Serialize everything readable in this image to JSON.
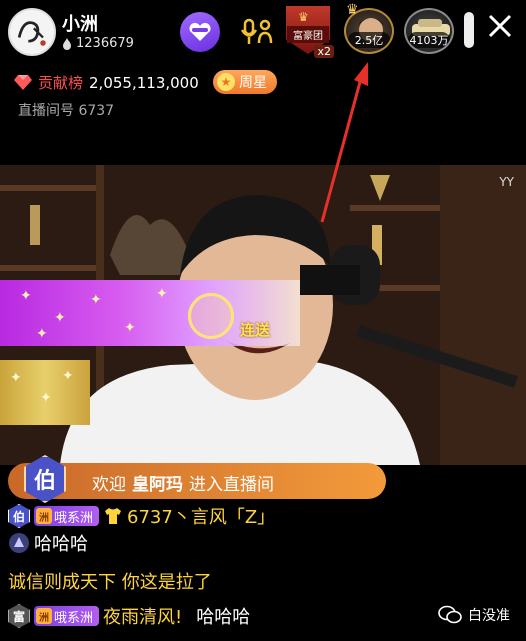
{
  "header": {
    "streamer_name": "小洲",
    "fans_count": "1236679",
    "follow_icon": "heart-plus-icon",
    "link_mic_icon": "mic-user-icon",
    "rich_group": {
      "label": "富豪团",
      "multiplier": "x2"
    },
    "rank_list": [
      {
        "value": "2.5亿"
      },
      {
        "value": "4103万"
      }
    ],
    "close_icon": "close-icon"
  },
  "contribution": {
    "label": "贡献榜",
    "value": "2,055,113,000"
  },
  "weekly_star": {
    "label": "周星"
  },
  "room": {
    "label": "直播间号",
    "id": "6737"
  },
  "video": {
    "watermark": "YY",
    "combo_label": "连送"
  },
  "welcome": {
    "level_char": "伯",
    "prefix": "欢迎",
    "user": "皇阿玛",
    "suffix": "进入直播间"
  },
  "chat": [
    {
      "badge": "伯",
      "badge_color": "#4a52c8",
      "fanclub": "哦系洲",
      "name": "6737丶言风「Z」",
      "text": ""
    },
    {
      "badge": "",
      "badge_color": "#6a6aa0",
      "fanclub": "",
      "name": "",
      "text": "哈哈哈"
    },
    {
      "badge": "",
      "badge_color": "",
      "fanclub": "",
      "name": "",
      "text": "诚信则成天下 你这是拉了"
    },
    {
      "badge": "富",
      "badge_color": "#555555",
      "fanclub": "哦系洲",
      "name": "夜雨清风!",
      "text": "哈哈哈"
    }
  ],
  "account_watermark": "白没准",
  "colors": {
    "accent_purple": "#7b3fe4",
    "contrib_red": "#ff4d4d",
    "name_yellow": "#ffd43b",
    "welcome_orange": "#f39a3b"
  }
}
